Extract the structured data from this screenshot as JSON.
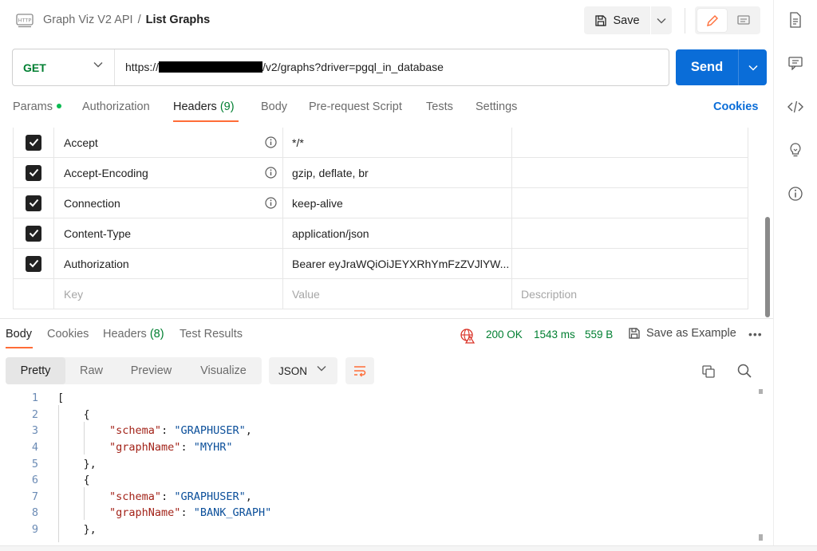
{
  "breadcrumb": {
    "collection": "Graph Viz V2 API",
    "separator": "/",
    "request": "List Graphs"
  },
  "toolbar": {
    "save_label": "Save"
  },
  "request": {
    "method": "GET",
    "url_prefix": "https://",
    "url_suffix": "/v2/graphs?driver=pgql_in_database",
    "send_label": "Send"
  },
  "request_tabs": {
    "params": "Params",
    "authorization": "Authorization",
    "headers": "Headers",
    "headers_count": "(9)",
    "body": "Body",
    "prerequest": "Pre-request Script",
    "tests": "Tests",
    "settings": "Settings",
    "cookies": "Cookies"
  },
  "headers": [
    {
      "key": "Accept",
      "value": "*/*",
      "info": true
    },
    {
      "key": "Accept-Encoding",
      "value": "gzip, deflate, br",
      "info": true
    },
    {
      "key": "Connection",
      "value": "keep-alive",
      "info": true
    },
    {
      "key": "Content-Type",
      "value": "application/json",
      "info": false
    },
    {
      "key": "Authorization",
      "value": "Bearer eyJraWQiOiJEYXRhYmFzZVJlYW...",
      "info": false
    }
  ],
  "headers_placeholder": {
    "key": "Key",
    "value": "Value",
    "description": "Description"
  },
  "response_tabs": {
    "body": "Body",
    "cookies": "Cookies",
    "headers": "Headers",
    "headers_count": "(8)",
    "test_results": "Test Results"
  },
  "response_status": {
    "status": "200 OK",
    "time": "1543 ms",
    "size": "559 B",
    "save_example": "Save as Example"
  },
  "response_view": {
    "pretty": "Pretty",
    "raw": "Raw",
    "preview": "Preview",
    "visualize": "Visualize",
    "format": "JSON"
  },
  "code": {
    "line_numbers": [
      "1",
      "2",
      "3",
      "4",
      "5",
      "6",
      "7",
      "8",
      "9"
    ],
    "open_bracket": "[",
    "open_brace": "{",
    "close_brace": "},",
    "schema_key": "\"schema\"",
    "graphname_key": "\"graphName\"",
    "colon": ": ",
    "comma": ",",
    "entries": [
      {
        "schema": "\"GRAPHUSER\"",
        "graphName": "\"MYHR\""
      },
      {
        "schema": "\"GRAPHUSER\"",
        "graphName": "\"BANK_GRAPH\""
      }
    ]
  },
  "colors": {
    "accent": "#ff6c37",
    "send": "#0a6dd8",
    "method_get": "#007f31",
    "status_ok": "#007f31"
  }
}
